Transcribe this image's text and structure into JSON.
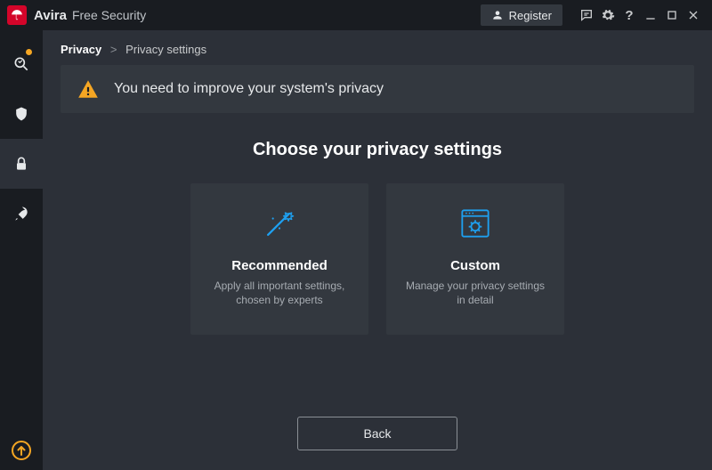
{
  "titlebar": {
    "brand": "Avira",
    "subtitle": "Free Security",
    "register": "Register"
  },
  "breadcrumb": {
    "root": "Privacy",
    "separator": ">",
    "current": "Privacy settings"
  },
  "alert": {
    "message": "You need to improve your system's privacy"
  },
  "section": {
    "title": "Choose your privacy settings"
  },
  "cards": {
    "recommended": {
      "title": "Recommended",
      "description": "Apply all important settings, chosen by experts"
    },
    "custom": {
      "title": "Custom",
      "description": "Manage your privacy settings in detail"
    }
  },
  "buttons": {
    "back": "Back"
  },
  "colors": {
    "accent": "#1ea0f0",
    "warn": "#f5a623",
    "brand": "#d4052a"
  }
}
